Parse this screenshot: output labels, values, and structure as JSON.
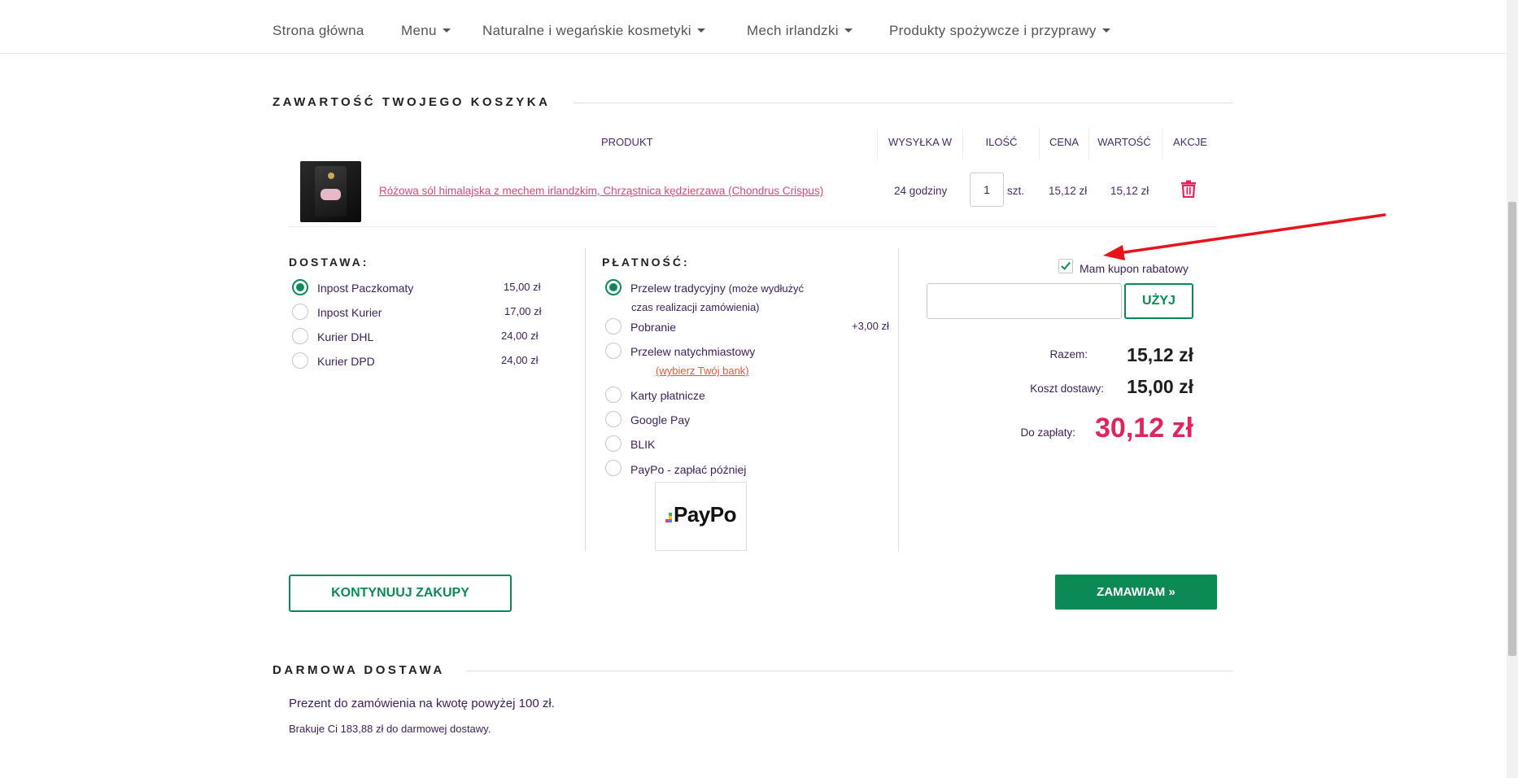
{
  "nav": {
    "items": [
      {
        "label": "Strona główna",
        "dropdown": false
      },
      {
        "label": "Menu",
        "dropdown": true
      },
      {
        "label": "Naturalne i wegańskie kosmetyki",
        "dropdown": true
      },
      {
        "label": "Mech irlandzki",
        "dropdown": true
      },
      {
        "label": "Produkty spożywcze i przyprawy",
        "dropdown": true
      }
    ]
  },
  "cart": {
    "title": "ZAWARTOŚĆ TWOJEGO KOSZYKA",
    "headers": {
      "product": "PRODUKT",
      "shipping": "WYSYŁKA W",
      "quantity": "ILOŚĆ",
      "price": "CENA",
      "value": "WARTOŚĆ",
      "actions": "AKCJE"
    },
    "rows": [
      {
        "name": "Różowa sól himalajska z mechem irlandzkim, Chrząstnica kędzierzawa (Chondrus Crispus)",
        "shipping": "24 godziny",
        "quantity": "1",
        "unit": "szt.",
        "price": "15,12 zł",
        "value": "15,12 zł"
      }
    ]
  },
  "delivery": {
    "title": "DOSTAWA:",
    "options": [
      {
        "label": "Inpost Paczkomaty",
        "price": "15,00 zł",
        "selected": true
      },
      {
        "label": "Inpost Kurier",
        "price": "17,00 zł",
        "selected": false
      },
      {
        "label": "Kurier DHL",
        "price": "24,00 zł",
        "selected": false
      },
      {
        "label": "Kurier DPD",
        "price": "24,00 zł",
        "selected": false
      }
    ]
  },
  "payment": {
    "title": "PŁATNOŚĆ:",
    "options": [
      {
        "label": "Przelew tradycyjny",
        "note": "(może wydłużyć",
        "note2": "czas realizacji zamówienia)",
        "selected": true
      },
      {
        "label": "Pobranie",
        "price": "+3,00 zł",
        "selected": false
      },
      {
        "label": "Przelew natychmiastowy",
        "link": "(wybierz Twój bank)",
        "selected": false
      },
      {
        "label": "Karty płatnicze",
        "selected": false
      },
      {
        "label": "Google Pay",
        "selected": false
      },
      {
        "label": "BLIK",
        "selected": false
      },
      {
        "label": "PayPo - zapłać później",
        "selected": false
      }
    ],
    "paypo_logo": "PayPo"
  },
  "coupon": {
    "checkbox_label": "Mam kupon rabatowy",
    "checked": true,
    "input_value": "",
    "apply_button": "UŻYJ"
  },
  "summary": {
    "subtotal_label": "Razem:",
    "subtotal": "15,12 zł",
    "shipping_label": "Koszt dostawy:",
    "shipping": "15,00 zł",
    "total_label": "Do zapłaty:",
    "total": "30,12 zł"
  },
  "actions": {
    "continue": "KONTYNUUJ ZAKUPY",
    "order": "ZAMAWIAM »"
  },
  "free_shipping": {
    "title": "DARMOWA DOSTAWA",
    "line1": "Prezent do zamówienia na kwotę powyżej 100 zł.",
    "line2": "Brakuje Ci 183,88 zł do darmowej dostawy."
  },
  "colors": {
    "accent_green": "#0c8a55",
    "price_pink": "#e0245e",
    "link_pink": "#e0457b",
    "annotation_red": "#e8141c"
  }
}
